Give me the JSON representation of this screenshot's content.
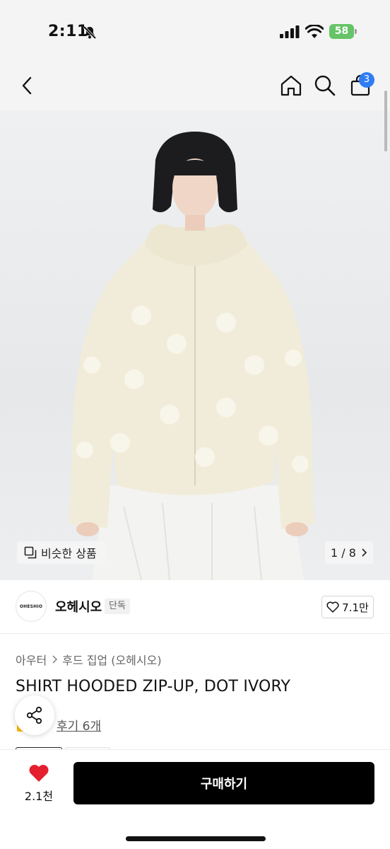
{
  "status_bar": {
    "time": "2:11",
    "battery": "58"
  },
  "nav": {
    "cart_count": "3"
  },
  "gallery": {
    "similar_label": "비슷한 상품",
    "counter": "1 / 8"
  },
  "brand": {
    "logo_text": "OHESHIO",
    "name": "오헤시오",
    "badge": "단독",
    "likes": "7.1만"
  },
  "product": {
    "breadcrumb": [
      "아우터",
      "후드 집업 (오헤시오)"
    ],
    "title": "SHIRT HOODED ZIP-UP, DOT IVORY",
    "reviews": "후기 6개"
  },
  "bottom_bar": {
    "wish_count": "2.1천",
    "buy_label": "구매하기"
  },
  "colors": {
    "accent_blue": "#2f7df6",
    "heart_red": "#e5202e",
    "battery_green": "#65c466",
    "buy_button": "#000000"
  },
  "icons": [
    "bell-off-icon",
    "signal-icon",
    "wifi-icon",
    "back-icon",
    "home-icon",
    "search-icon",
    "shopping-bag-icon",
    "similar-items-icon",
    "chevron-right-icon",
    "heart-outline-icon",
    "share-icon",
    "heart-filled-icon"
  ]
}
